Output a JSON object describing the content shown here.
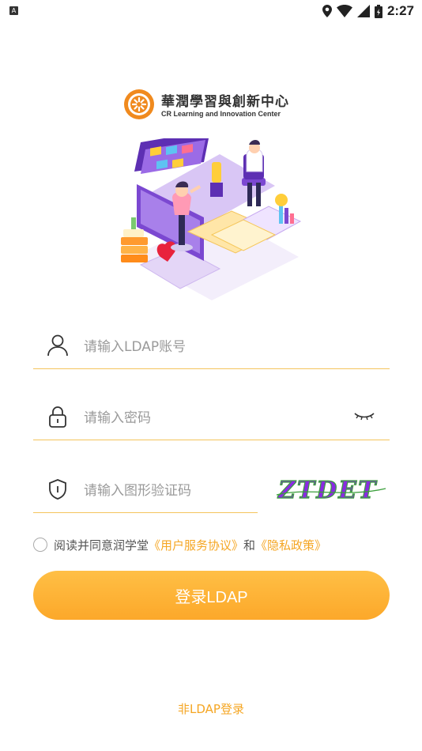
{
  "status_bar": {
    "notification_icon": "A",
    "time": "2:27",
    "icons": [
      "location-icon",
      "wifi-icon",
      "signal-icon",
      "battery-icon"
    ]
  },
  "logo": {
    "chinese": "華潤學習與創新中心",
    "english": "CR Learning and Innovation Center"
  },
  "form": {
    "account_placeholder": "请输入LDAP账号",
    "password_placeholder": "请输入密码",
    "captcha_placeholder": "请输入图形验证码",
    "captcha_text": "ZTDET"
  },
  "agreement": {
    "prefix": "阅读并同意润学堂",
    "user_agreement": "《用户服务协议》",
    "and": "和",
    "privacy_policy": "《隐私政策》"
  },
  "login_button": "登录LDAP",
  "alt_login": "非LDAP登录",
  "colors": {
    "accent": "#f5a623",
    "underline": "#f4c45c",
    "button": "#fcae33"
  }
}
